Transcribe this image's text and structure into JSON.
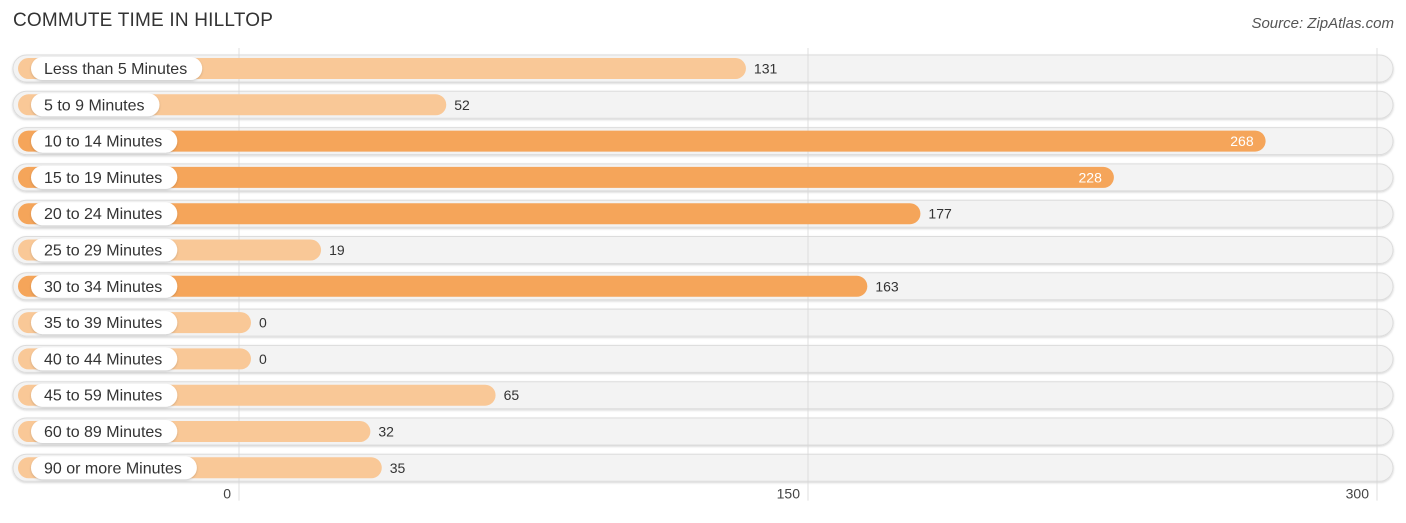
{
  "header": {
    "title": "COMMUTE TIME IN HILLTOP",
    "source": "Source: ZipAtlas.com"
  },
  "colors": {
    "bar_strong": "#f5a55a",
    "bar_light": "#f9c897",
    "track": "#f3f3f3",
    "track_border": "#dcdcdc",
    "grid": "#d8d8d8",
    "label_text": "#333333",
    "value_text_inside": "#ffffff",
    "value_text_outside": "#333333"
  },
  "chart_data": {
    "type": "bar",
    "orientation": "horizontal",
    "title": "COMMUTE TIME IN HILLTOP",
    "xlabel": "",
    "ylabel": "",
    "categories": [
      "Less than 5 Minutes",
      "5 to 9 Minutes",
      "10 to 14 Minutes",
      "15 to 19 Minutes",
      "20 to 24 Minutes",
      "25 to 29 Minutes",
      "30 to 34 Minutes",
      "35 to 39 Minutes",
      "40 to 44 Minutes",
      "45 to 59 Minutes",
      "60 to 89 Minutes",
      "90 or more Minutes"
    ],
    "values": [
      131,
      52,
      268,
      228,
      177,
      19,
      163,
      0,
      0,
      65,
      32,
      35
    ],
    "xlim": [
      0,
      300
    ],
    "xticks": [
      0,
      150,
      300
    ],
    "grid": true,
    "legend": "none"
  }
}
